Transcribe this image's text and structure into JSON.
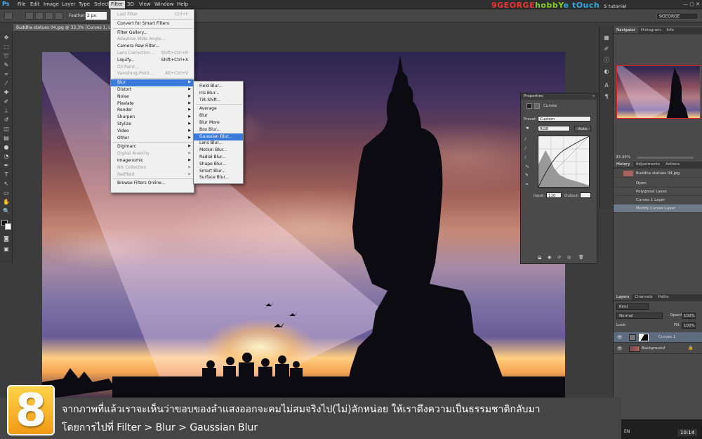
{
  "menubar": {
    "logo": "Ps",
    "items": [
      "File",
      "Edit",
      "Image",
      "Layer",
      "Type",
      "Select",
      "Filter",
      "3D",
      "View",
      "Window",
      "Help"
    ],
    "active": "Filter"
  },
  "brand": {
    "part1": "9GEORGE",
    "part2": "hobbY",
    "part3": "e tOuch",
    "part4": "S tutorial"
  },
  "window_controls": "—  ▢  ✕",
  "options_bar": {
    "feather_label": "Feather:",
    "feather_value": "2 px"
  },
  "workspace": "9GEORGE",
  "document_tab": "Buddha statues 04.jpg @ 33.3% (Curves 1, Layer Mask/8) *",
  "filter_menu": {
    "items": [
      {
        "label": "Last Filter",
        "shortcut": "Ctrl+F",
        "disabled": true
      },
      {
        "sep": true
      },
      {
        "label": "Convert for Smart Filters"
      },
      {
        "sep": true
      },
      {
        "label": "Filter Gallery..."
      },
      {
        "label": "Adaptive Wide Angle...",
        "disabled": true
      },
      {
        "label": "Camera Raw Filter..."
      },
      {
        "label": "Lens Correction...",
        "shortcut": "Shift+Ctrl+R",
        "disabled": true
      },
      {
        "label": "Liquify...",
        "shortcut": "Shift+Ctrl+X"
      },
      {
        "label": "Oil Paint...",
        "disabled": true
      },
      {
        "label": "Vanishing Point...",
        "shortcut": "Alt+Ctrl+V",
        "disabled": true
      },
      {
        "sep": true
      },
      {
        "label": "Blur",
        "submenu": true,
        "highlight": true
      },
      {
        "label": "Distort",
        "submenu": true
      },
      {
        "label": "Noise",
        "submenu": true
      },
      {
        "label": "Pixelate",
        "submenu": true
      },
      {
        "label": "Render",
        "submenu": true
      },
      {
        "label": "Sharpen",
        "submenu": true
      },
      {
        "label": "Stylize",
        "submenu": true
      },
      {
        "label": "Video",
        "submenu": true
      },
      {
        "label": "Other",
        "submenu": true
      },
      {
        "sep": true
      },
      {
        "label": "Digimarc",
        "submenu": true
      },
      {
        "label": "Digital Anarchy",
        "submenu": true,
        "disabled": true
      },
      {
        "label": "Imagenomic",
        "submenu": true
      },
      {
        "label": "Nik Collection",
        "submenu": true,
        "disabled": true
      },
      {
        "label": "Redfield",
        "submenu": true,
        "disabled": true
      },
      {
        "sep": true
      },
      {
        "label": "Browse Filters Online..."
      }
    ]
  },
  "blur_menu": {
    "items": [
      {
        "label": "Field Blur..."
      },
      {
        "label": "Iris Blur..."
      },
      {
        "label": "Tilt-Shift..."
      },
      {
        "sep": true
      },
      {
        "label": "Average"
      },
      {
        "label": "Blur"
      },
      {
        "label": "Blur More"
      },
      {
        "label": "Box Blur..."
      },
      {
        "label": "Gaussian Blur...",
        "highlight": true
      },
      {
        "label": "Lens Blur..."
      },
      {
        "label": "Motion Blur..."
      },
      {
        "label": "Radial Blur..."
      },
      {
        "label": "Shape Blur..."
      },
      {
        "label": "Smart Blur..."
      },
      {
        "label": "Surface Blur..."
      }
    ]
  },
  "properties": {
    "title": "Properties",
    "type": "Curves",
    "preset_label": "Preset:",
    "preset_value": "Custom",
    "channel": "RGB",
    "auto": "Auto",
    "input_label": "Input:",
    "input_value": "110",
    "output_label": "Output:"
  },
  "navigator": {
    "tabs": [
      "Navigator",
      "Histogram",
      "Info"
    ],
    "zoom": "33.33%"
  },
  "history": {
    "tabs": [
      "History",
      "Adjustments",
      "Actions"
    ],
    "snapshot": "Buddha statues 04.jpg",
    "items": [
      "Open",
      "Polygonal Lasso",
      "Curves 1 Layer",
      "Modify Curves Layer"
    ]
  },
  "layers": {
    "tabs": [
      "Layers",
      "Channels",
      "Paths"
    ],
    "kind": "Kind",
    "blend": "Normal",
    "opacity_label": "Opacity:",
    "opacity": "100%",
    "lock_label": "Lock:",
    "fill_label": "Fill:",
    "fill": "100%",
    "rows": [
      {
        "name": "Curves 1",
        "active": true
      },
      {
        "name": "Background",
        "active": false
      }
    ]
  },
  "caption": {
    "step": "8",
    "line1": "จากภาพที่แล้วเราจะเห็นว่าขอบของลำแสงออกจะคมไม่สมจริงไป(ไม่)ลักหน่อย ให้เราดึงความเป็นธรรมชาติกลับมา",
    "line2": "โดยการไปที่ Filter > Blur > Gaussian Blur"
  },
  "taskbar": {
    "lang": "EN",
    "time": "10:14"
  }
}
